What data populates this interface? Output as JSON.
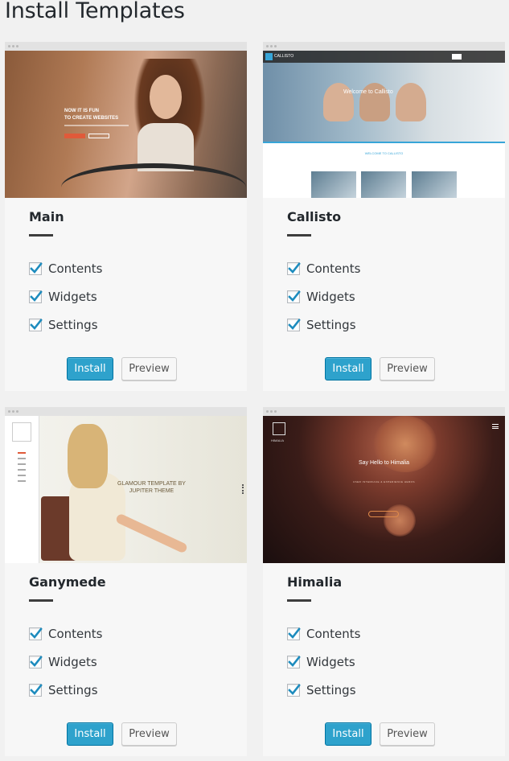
{
  "page": {
    "title": "Install Templates"
  },
  "templates": [
    {
      "name": "Main",
      "options": [
        "Contents",
        "Widgets",
        "Settings"
      ],
      "install_label": "Install",
      "preview_label": "Preview",
      "thumbnail": {
        "headline_1": "NOW IT IS FUN",
        "headline_2": "TO CREATE WEBSITES"
      }
    },
    {
      "name": "Callisto",
      "options": [
        "Contents",
        "Widgets",
        "Settings"
      ],
      "install_label": "Install",
      "preview_label": "Preview",
      "thumbnail": {
        "logo_text": "CALLISTO",
        "headline": "Welcome to Callisto",
        "section_title": "WELCOME TO CALLISTO"
      }
    },
    {
      "name": "Ganymede",
      "options": [
        "Contents",
        "Widgets",
        "Settings"
      ],
      "install_label": "Install",
      "preview_label": "Preview",
      "thumbnail": {
        "headline_1": "GLAMOUR TEMPLATE BY",
        "headline_2": "JUPITER THEME"
      }
    },
    {
      "name": "Himalia",
      "options": [
        "Contents",
        "Widgets",
        "Settings"
      ],
      "install_label": "Install",
      "preview_label": "Preview",
      "thumbnail": {
        "logo_text": "HIMALIA",
        "headline": "Say Hello to Himalia",
        "subline": "USER INTERFACE & EXPERIENCE HEROS"
      }
    }
  ],
  "colors": {
    "install_button": "#2ea2cc",
    "checkbox_check": "#1e8cbe",
    "page_bg": "#f1f1f1",
    "card_bg": "#f7f7f7"
  }
}
